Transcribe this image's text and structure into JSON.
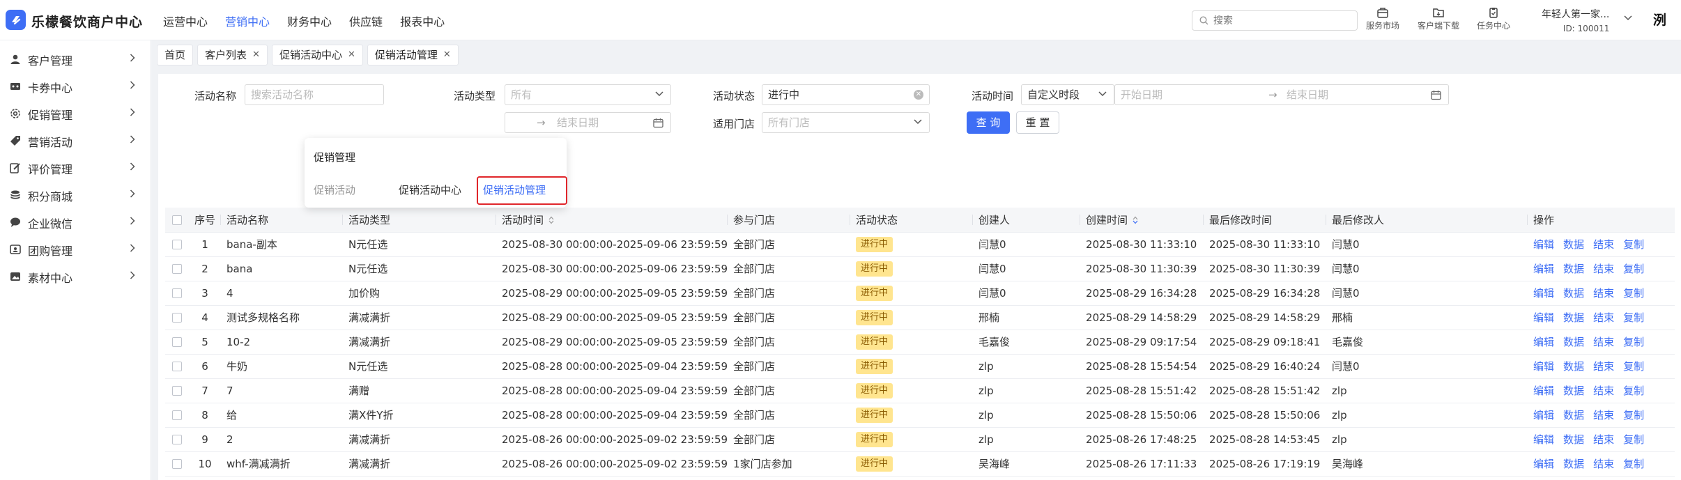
{
  "brand": {
    "name": "乐檬餐饮商户中心",
    "accent": "#3e6ef5"
  },
  "topnav": [
    "运营中心",
    "营销中心",
    "财务中心",
    "供应链",
    "报表中心"
  ],
  "topnav_active": "营销中心",
  "search": {
    "placeholder": "搜索"
  },
  "tools": {
    "service_market": "服务市场",
    "client_download": "客户端下载",
    "task_center": "任务中心"
  },
  "user": {
    "name": "年轻人第一家...",
    "id": "ID: 100011",
    "avatar_char": "洌"
  },
  "sidebar": [
    {
      "label": "客户管理",
      "icon": "user-icon"
    },
    {
      "label": "卡券中心",
      "icon": "ticket-icon"
    },
    {
      "label": "促销管理",
      "icon": "gear-icon"
    },
    {
      "label": "营销活动",
      "icon": "tag-icon"
    },
    {
      "label": "评价管理",
      "icon": "edit-icon"
    },
    {
      "label": "积分商城",
      "icon": "coins-icon"
    },
    {
      "label": "企业微信",
      "icon": "chat-icon"
    },
    {
      "label": "团购管理",
      "icon": "group-icon"
    },
    {
      "label": "素材中心",
      "icon": "image-icon"
    }
  ],
  "tabs": [
    {
      "label": "首页",
      "closable": false
    },
    {
      "label": "客户列表",
      "closable": true
    },
    {
      "label": "促销活动中心",
      "closable": true
    },
    {
      "label": "促销活动管理",
      "closable": true
    }
  ],
  "filters": {
    "name_label": "活动名称",
    "name_placeholder": "搜索活动名称",
    "type_label": "活动类型",
    "type_value": "所有",
    "status_label": "活动状态",
    "status_value": "进行中",
    "time_label": "活动时间",
    "time_mode": "自定义时段",
    "start_placeholder": "开始日期",
    "end_placeholder": "结束日期",
    "end_date_placeholder2": "结束日期",
    "store_label": "适用门店",
    "store_value": "所有门店",
    "query": "查 询",
    "reset": "重 置"
  },
  "popover": {
    "title": "促销管理",
    "item1": "促销活动",
    "item2": "促销活动中心",
    "item3": "促销活动管理"
  },
  "table": {
    "headers": [
      "序号",
      "活动名称",
      "活动类型",
      "活动时间",
      "参与门店",
      "活动状态",
      "创建人",
      "创建时间",
      "最后修改时间",
      "最后修改人",
      "操作"
    ],
    "ops": [
      "编辑",
      "数据",
      "结束",
      "复制"
    ],
    "rows": [
      [
        "1",
        "bana-副本",
        "N元任选",
        "2025-08-30 00:00:00-2025-09-06 23:59:59",
        "全部门店",
        "进行中",
        "闫慧0",
        "2025-08-30 11:33:10",
        "2025-08-30 11:33:10",
        "闫慧0"
      ],
      [
        "2",
        "bana",
        "N元任选",
        "2025-08-30 00:00:00-2025-09-06 23:59:59",
        "全部门店",
        "进行中",
        "闫慧0",
        "2025-08-30 11:30:39",
        "2025-08-30 11:30:39",
        "闫慧0"
      ],
      [
        "3",
        "4",
        "加价购",
        "2025-08-29 00:00:00-2025-09-05 23:59:59",
        "全部门店",
        "进行中",
        "闫慧0",
        "2025-08-29 16:34:28",
        "2025-08-29 16:34:28",
        "闫慧0"
      ],
      [
        "4",
        "测试多规格名称",
        "满减满折",
        "2025-08-29 00:00:00-2025-09-05 23:59:59",
        "全部门店",
        "进行中",
        "邢楠",
        "2025-08-29 14:58:29",
        "2025-08-29 14:58:29",
        "邢楠"
      ],
      [
        "5",
        "10-2",
        "满减满折",
        "2025-08-29 00:00:00-2025-09-05 23:59:59",
        "全部门店",
        "进行中",
        "毛嘉俊",
        "2025-08-29 09:17:54",
        "2025-08-29 09:18:41",
        "毛嘉俊"
      ],
      [
        "6",
        "牛奶",
        "N元任选",
        "2025-08-28 00:00:00-2025-09-04 23:59:59",
        "全部门店",
        "进行中",
        "zlp",
        "2025-08-28 15:54:54",
        "2025-08-29 16:40:24",
        "闫慧0"
      ],
      [
        "7",
        "7",
        "满赠",
        "2025-08-28 00:00:00-2025-09-04 23:59:59",
        "全部门店",
        "进行中",
        "zlp",
        "2025-08-28 15:51:42",
        "2025-08-28 15:51:42",
        "zlp"
      ],
      [
        "8",
        "给",
        "满X件Y折",
        "2025-08-28 00:00:00-2025-09-04 23:59:59",
        "全部门店",
        "进行中",
        "zlp",
        "2025-08-28 15:50:06",
        "2025-08-28 15:50:06",
        "zlp"
      ],
      [
        "9",
        "2",
        "满减满折",
        "2025-08-26 00:00:00-2025-09-02 23:59:59",
        "全部门店",
        "进行中",
        "zlp",
        "2025-08-26 17:48:25",
        "2025-08-28 14:53:45",
        "zlp"
      ],
      [
        "10",
        "whf-满减满折",
        "满减满折",
        "2025-08-26 00:00:00-2025-09-02 23:59:59",
        "1家门店参加",
        "进行中",
        "吴海峰",
        "2025-08-26 17:11:33",
        "2025-08-26 17:19:19",
        "吴海峰"
      ]
    ]
  }
}
